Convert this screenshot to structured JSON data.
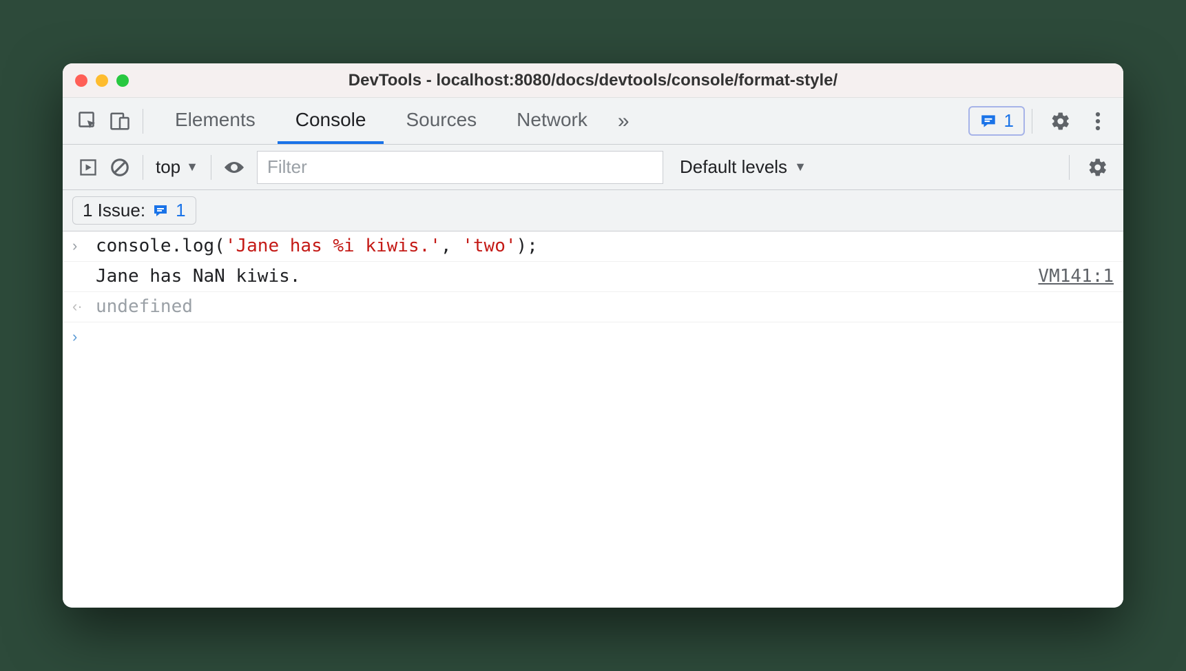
{
  "window": {
    "title": "DevTools - localhost:8080/docs/devtools/console/format-style/"
  },
  "tabs": {
    "elements": "Elements",
    "console": "Console",
    "sources": "Sources",
    "network": "Network"
  },
  "issues_pill": {
    "count": "1"
  },
  "filterbar": {
    "context": "top",
    "filter_placeholder": "Filter",
    "levels": "Default levels"
  },
  "issues_chip": {
    "label": "1 Issue:",
    "count": "1"
  },
  "console": {
    "input_code_prefix": "console.log(",
    "input_code_str1": "'Jane has %i kiwis.'",
    "input_code_mid": ", ",
    "input_code_str2": "'two'",
    "input_code_suffix": ");",
    "output_text": "Jane has NaN kiwis.",
    "source_link": "VM141:1",
    "return_value": "undefined"
  }
}
